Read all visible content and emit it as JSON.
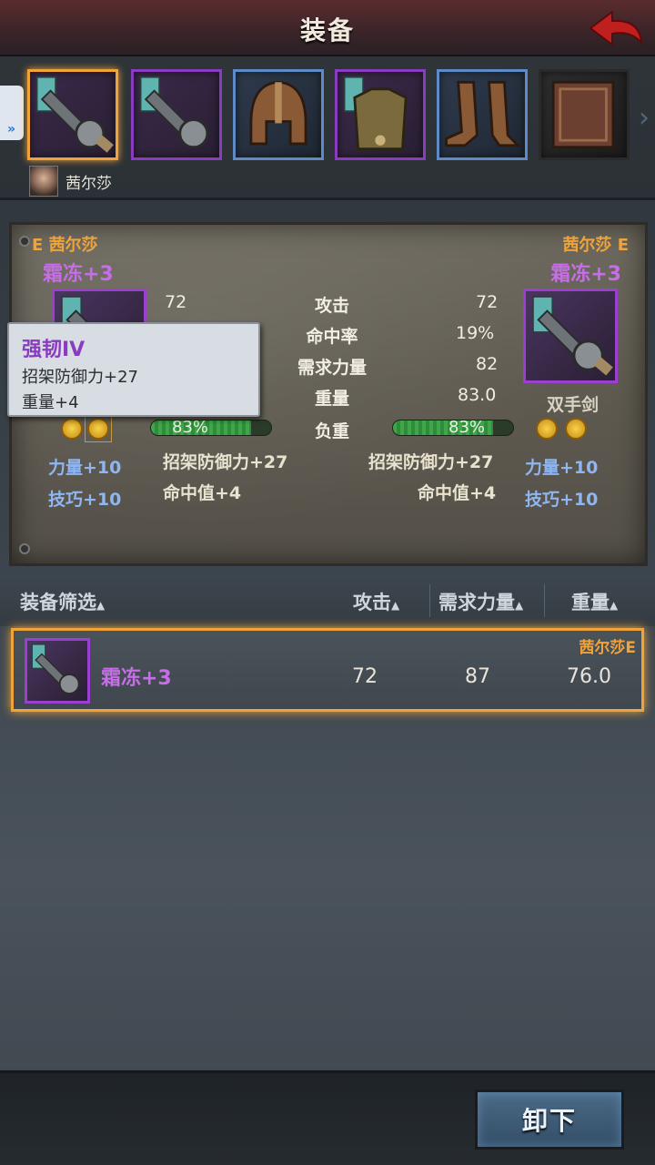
{
  "header": {
    "title": "装备"
  },
  "slots": [
    {
      "name": "weapon-main",
      "selected": true
    },
    {
      "name": "weapon-off",
      "selected": false
    },
    {
      "name": "helmet",
      "selected": false
    },
    {
      "name": "armor",
      "selected": false
    },
    {
      "name": "boots",
      "selected": false
    },
    {
      "name": "book",
      "selected": false
    }
  ],
  "character": {
    "name": "茜尔莎"
  },
  "compare": {
    "left": {
      "owner": "E 茜尔莎",
      "item": "霜冻+3"
    },
    "right": {
      "owner": "茜尔莎 E",
      "item": "霜冻+3",
      "type": "双手剑"
    },
    "stats": [
      {
        "label": "攻击",
        "left": "72",
        "right": "72"
      },
      {
        "label": "命中率",
        "left": "",
        "right": "19%"
      },
      {
        "label": "需求力量",
        "left": "",
        "right": "82"
      },
      {
        "label": "重量",
        "left": "",
        "right": "83.0"
      }
    ],
    "load": {
      "label": "负重",
      "left": "83%",
      "right": "83%",
      "left_fill": 0.83,
      "right_fill": 0.83
    },
    "left_bonus": [
      "招架防御力+27",
      "命中值+4"
    ],
    "right_bonus": [
      "招架防御力+27",
      "命中值+4"
    ],
    "left_attrs": [
      "力量+10",
      "技巧+10"
    ],
    "right_attrs": [
      "力量+10",
      "技巧+10"
    ]
  },
  "tooltip": {
    "title": "强韧IV",
    "lines": [
      "招架防御力+27",
      "重量+4"
    ]
  },
  "filter": {
    "label": "装备筛选",
    "col_attack": "攻击",
    "col_req": "需求力量",
    "col_weight": "重量"
  },
  "list": [
    {
      "owner": "茜尔莎E",
      "name": "霜冻+3",
      "attack": "72",
      "req": "87",
      "weight": "76.0"
    }
  ],
  "actions": {
    "unequip": "卸下"
  }
}
